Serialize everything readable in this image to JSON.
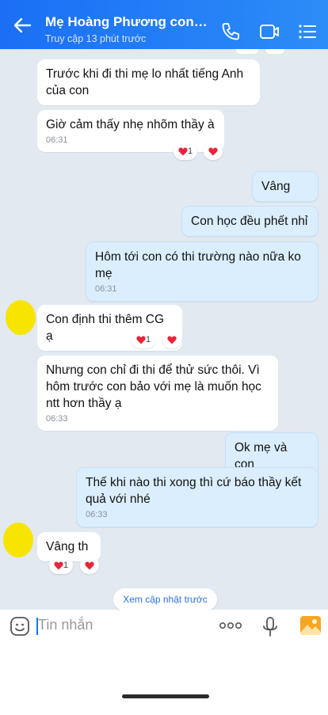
{
  "header": {
    "title": "Mẹ Hoàng Phương con T...",
    "subtitle": "Truy cập 13 phút trước",
    "icons": [
      "back-arrow-icon",
      "phone-icon",
      "video-call-icon",
      "menu-list-icon"
    ]
  },
  "messages": [
    {
      "text": "Trước khi đi thi mẹ lo nhất tiếng Anh của con",
      "side": "in"
    },
    {
      "text": "Giờ cảm thấy nhẹ nhõm thầy à",
      "time": "06:31",
      "side": "in",
      "reaction_count": "1"
    },
    {
      "text": "Vâng",
      "side": "out"
    },
    {
      "text": "Con học đều phết nhỉ",
      "side": "out"
    },
    {
      "text": "Hôm tới con có thi trường nào nữa ko mẹ",
      "time": "06:31",
      "side": "out"
    },
    {
      "text": "Con định thi thêm CG ạ",
      "side": "in",
      "reaction_count": "1"
    },
    {
      "text": "Nhưng con chỉ đi thi để thử sức thôi. Vì hôm trước con bảo với mẹ là muốn học ntt hơn thầy ạ",
      "time": "06:33",
      "side": "in"
    },
    {
      "text": "Ok mẹ và con",
      "side": "out"
    },
    {
      "text": "Thế khi nào thi xong thì cứ báo thầy kết quả với nhé",
      "time": "06:33",
      "side": "out"
    },
    {
      "text": "Vâng th",
      "side": "in",
      "reaction_count": "1"
    }
  ],
  "history_pill": "Xem cập nhật trước",
  "input": {
    "placeholder": "Tin nhắn",
    "icons": [
      "sticker-icon",
      "more-icon",
      "microphone-icon",
      "image-icon"
    ]
  },
  "colors": {
    "header": "#1a6ff5",
    "background": "#e2e9f1",
    "outgoing_bubble": "#dbeefe",
    "heart": "#e8243a",
    "avatar": "#f7e400"
  }
}
